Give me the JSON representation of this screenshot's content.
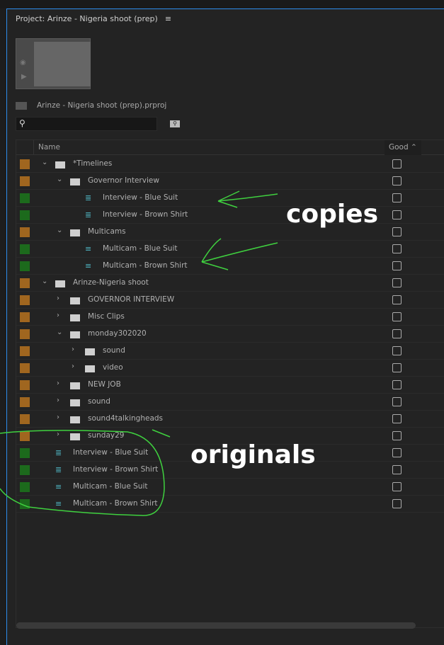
{
  "panel": {
    "title": "Project: Arinze - Nigeria shoot (prep)",
    "menu_icon": "hamburger-icon",
    "project_file": "Arinze - Nigeria shoot (prep).prproj",
    "search_placeholder": ""
  },
  "table": {
    "col_name": "Name",
    "col_good": "Good"
  },
  "label_colors": {
    "folder": "#a0661f",
    "sequence": "#1c6a1c"
  },
  "rows": [
    {
      "name": "*Timelines",
      "type": "folder",
      "level": 0,
      "chevron": "open",
      "label": "folder"
    },
    {
      "name": "Governor Interview",
      "type": "folder",
      "level": 1,
      "chevron": "open",
      "label": "folder"
    },
    {
      "name": "Interview - Blue Suit",
      "type": "sequence",
      "level": 2,
      "chevron": "none",
      "label": "sequence"
    },
    {
      "name": "Interview - Brown Shirt",
      "type": "sequence",
      "level": 2,
      "chevron": "none",
      "label": "sequence"
    },
    {
      "name": "Multicams",
      "type": "folder",
      "level": 1,
      "chevron": "open",
      "label": "folder"
    },
    {
      "name": "Multicam - Blue Suit",
      "type": "multicam",
      "level": 2,
      "chevron": "none",
      "label": "sequence"
    },
    {
      "name": "Multicam - Brown Shirt",
      "type": "multicam",
      "level": 2,
      "chevron": "none",
      "label": "sequence"
    },
    {
      "name": "Arinze-Nigeria shoot",
      "type": "folder",
      "level": 0,
      "chevron": "open",
      "label": "folder"
    },
    {
      "name": "GOVERNOR INTERVIEW",
      "type": "folder",
      "level": 1,
      "chevron": "closed",
      "label": "folder"
    },
    {
      "name": "Misc Clips",
      "type": "folder",
      "level": 1,
      "chevron": "closed",
      "label": "folder"
    },
    {
      "name": "monday302020",
      "type": "folder",
      "level": 1,
      "chevron": "open",
      "label": "folder"
    },
    {
      "name": "sound",
      "type": "folder",
      "level": 2,
      "chevron": "closed",
      "label": "folder"
    },
    {
      "name": "video",
      "type": "folder",
      "level": 2,
      "chevron": "closed",
      "label": "folder"
    },
    {
      "name": "NEW JOB",
      "type": "folder",
      "level": 1,
      "chevron": "closed",
      "label": "folder"
    },
    {
      "name": "sound",
      "type": "folder",
      "level": 1,
      "chevron": "closed",
      "label": "folder"
    },
    {
      "name": "sound4talkingheads",
      "type": "folder",
      "level": 1,
      "chevron": "closed",
      "label": "folder"
    },
    {
      "name": "sunday29",
      "type": "folder",
      "level": 1,
      "chevron": "closed",
      "label": "folder"
    },
    {
      "name": "Interview - Blue Suit",
      "type": "sequence",
      "level": 0,
      "chevron": "none",
      "label": "sequence"
    },
    {
      "name": "Interview - Brown Shirt",
      "type": "sequence",
      "level": 0,
      "chevron": "none",
      "label": "sequence"
    },
    {
      "name": "Multicam - Blue Suit",
      "type": "multicam",
      "level": 0,
      "chevron": "none",
      "label": "sequence"
    },
    {
      "name": "Multicam - Brown Shirt",
      "type": "multicam",
      "level": 0,
      "chevron": "none",
      "label": "sequence"
    }
  ],
  "annotations": {
    "copies": "copies",
    "originals": "originals",
    "color": "#3fd13f"
  }
}
